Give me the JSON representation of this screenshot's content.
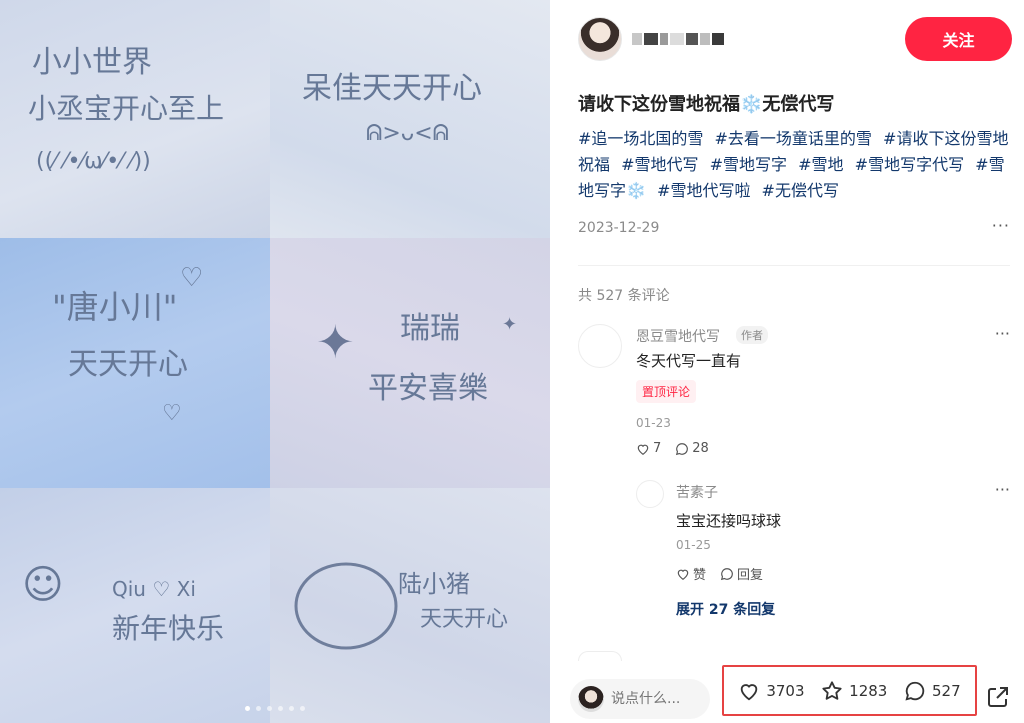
{
  "author": {
    "avatar_icon": "avatar-photo",
    "follow_label": "关注"
  },
  "post": {
    "title": "请收下这份雪地祝福❄️无偿代写",
    "hashtags": [
      "#追一场北国的雪",
      "#去看一场童话里的雪",
      "#请收下这份雪地祝福",
      "#雪地代写",
      "#雪地写字",
      "#雪地",
      "#雪地写字代写",
      "#雪地写字❄️",
      "#雪地代写啦",
      "#无偿代写"
    ],
    "date": "2023-12-29",
    "more_icon": "···"
  },
  "images": {
    "snow_texts": [
      [
        "小小世界",
        "小丞宝开心至上",
        "((⁄ ⁄•⁄ω⁄•⁄ ⁄))"
      ],
      [
        "呆佳天天开心",
        "ᕱ>ᴗ<ᕱ"
      ],
      [
        "\"唐小川\"",
        "天天开心"
      ],
      [
        "瑞瑞",
        "平安喜樂"
      ],
      [
        "Qiu ♡ Xi",
        "新年快乐"
      ],
      [
        "陆小猪",
        "天天开心"
      ]
    ],
    "dot_count": 6,
    "active_dot": 0
  },
  "comments": {
    "count_label": "共 527 条评论",
    "items": [
      {
        "name": "恩豆雪地代写",
        "badge": "作者",
        "text": "冬天代写一直有",
        "pin_label": "置顶评论",
        "date": "01-23",
        "likes": "7",
        "replies": "28"
      }
    ],
    "reply": {
      "name": "苦素子",
      "text": "宝宝还接吗球球",
      "date": "01-25",
      "like_label": "赞",
      "reply_label": "回复"
    },
    "expand_label": "展开 27 条回复"
  },
  "bottom_bar": {
    "input_placeholder": "说点什么...",
    "likes": "3703",
    "collects": "1283",
    "comments": "527"
  },
  "colors": {
    "brand_red": "#ff2442",
    "highlight_box": "#e64343",
    "hashtag_blue": "#13386c"
  }
}
